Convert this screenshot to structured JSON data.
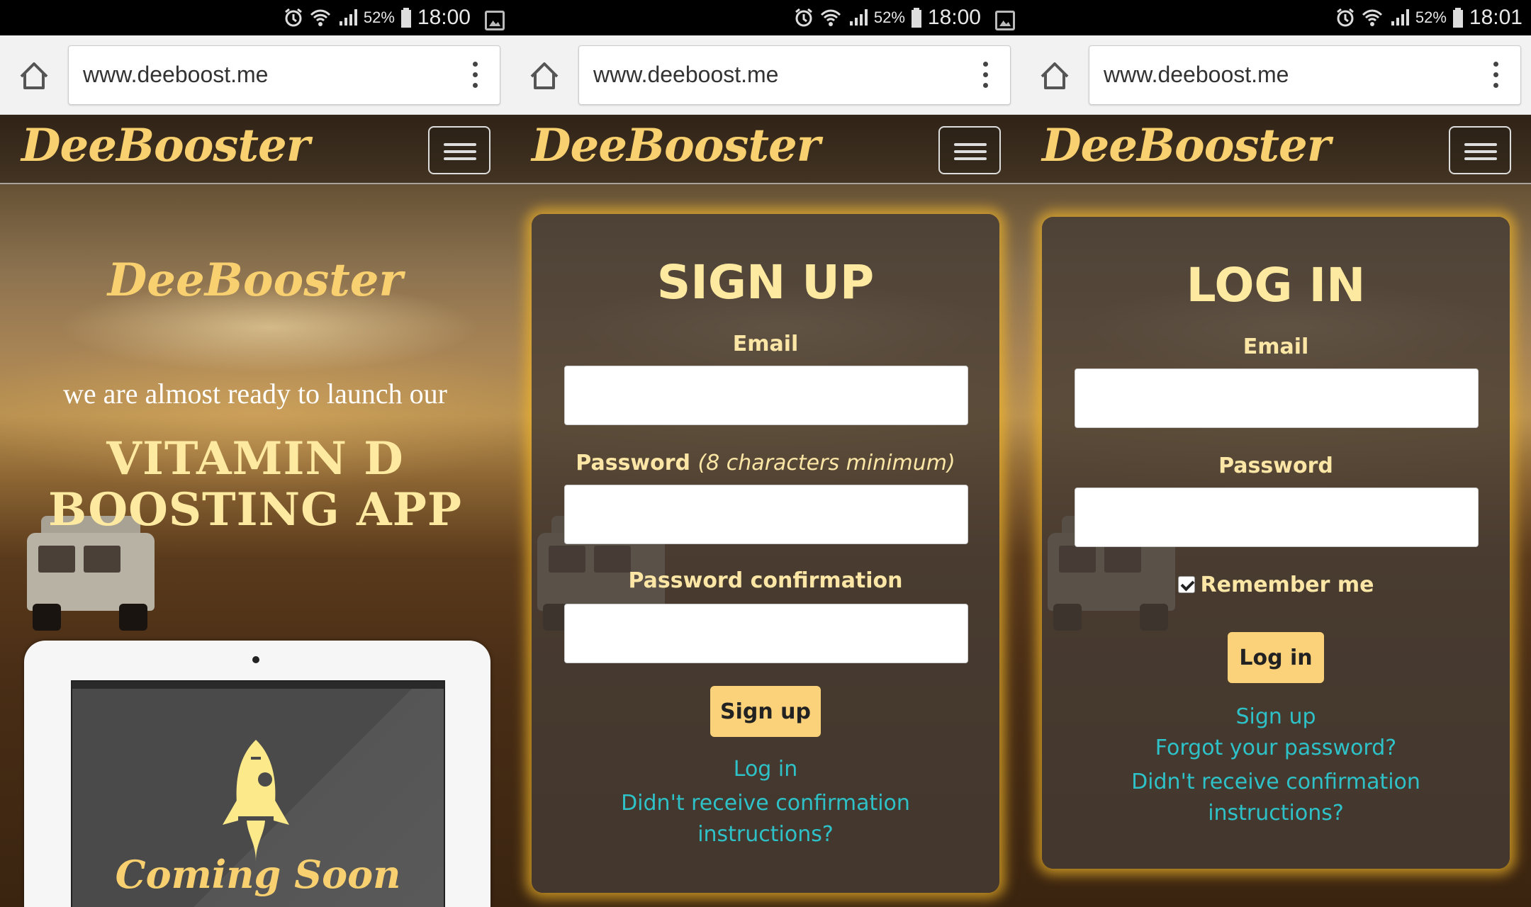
{
  "status_bars": [
    {
      "battery": "52%",
      "time": "18:00"
    },
    {
      "battery": "52%",
      "time": "18:00"
    },
    {
      "battery": "52%",
      "time": "18:01"
    }
  ],
  "url": "www.deeboost.me",
  "brand": "DeeBooster",
  "landing": {
    "logo": "DeeBooster",
    "subtitle": "we are almost ready to launch our",
    "title_line1": "VITAMIN D",
    "title_line2": "BOOSTING APP",
    "coming_soon": "Coming Soon"
  },
  "signup": {
    "title": "SIGN UP",
    "email_label": "Email",
    "password_label": "Password",
    "password_hint": "(8 characters minimum)",
    "password_confirmation_label": "Password confirmation",
    "submit_label": "Sign up",
    "links": {
      "login": "Log in",
      "confirmation_line1": "Didn't receive confirmation",
      "confirmation_line2": "instructions?"
    }
  },
  "login": {
    "title": "LOG IN",
    "email_label": "Email",
    "password_label": "Password",
    "remember_label": "Remember me",
    "remember_checked": true,
    "submit_label": "Log in",
    "links": {
      "signup": "Sign up",
      "forgot": "Forgot your password?",
      "confirmation_line1": "Didn't receive confirmation",
      "confirmation_line2": "instructions?"
    }
  },
  "colors": {
    "brand_yellow": "#f9d070",
    "button_yellow": "#fbd27a",
    "link_teal": "#2ec2c8",
    "glow": "#f0b428"
  }
}
